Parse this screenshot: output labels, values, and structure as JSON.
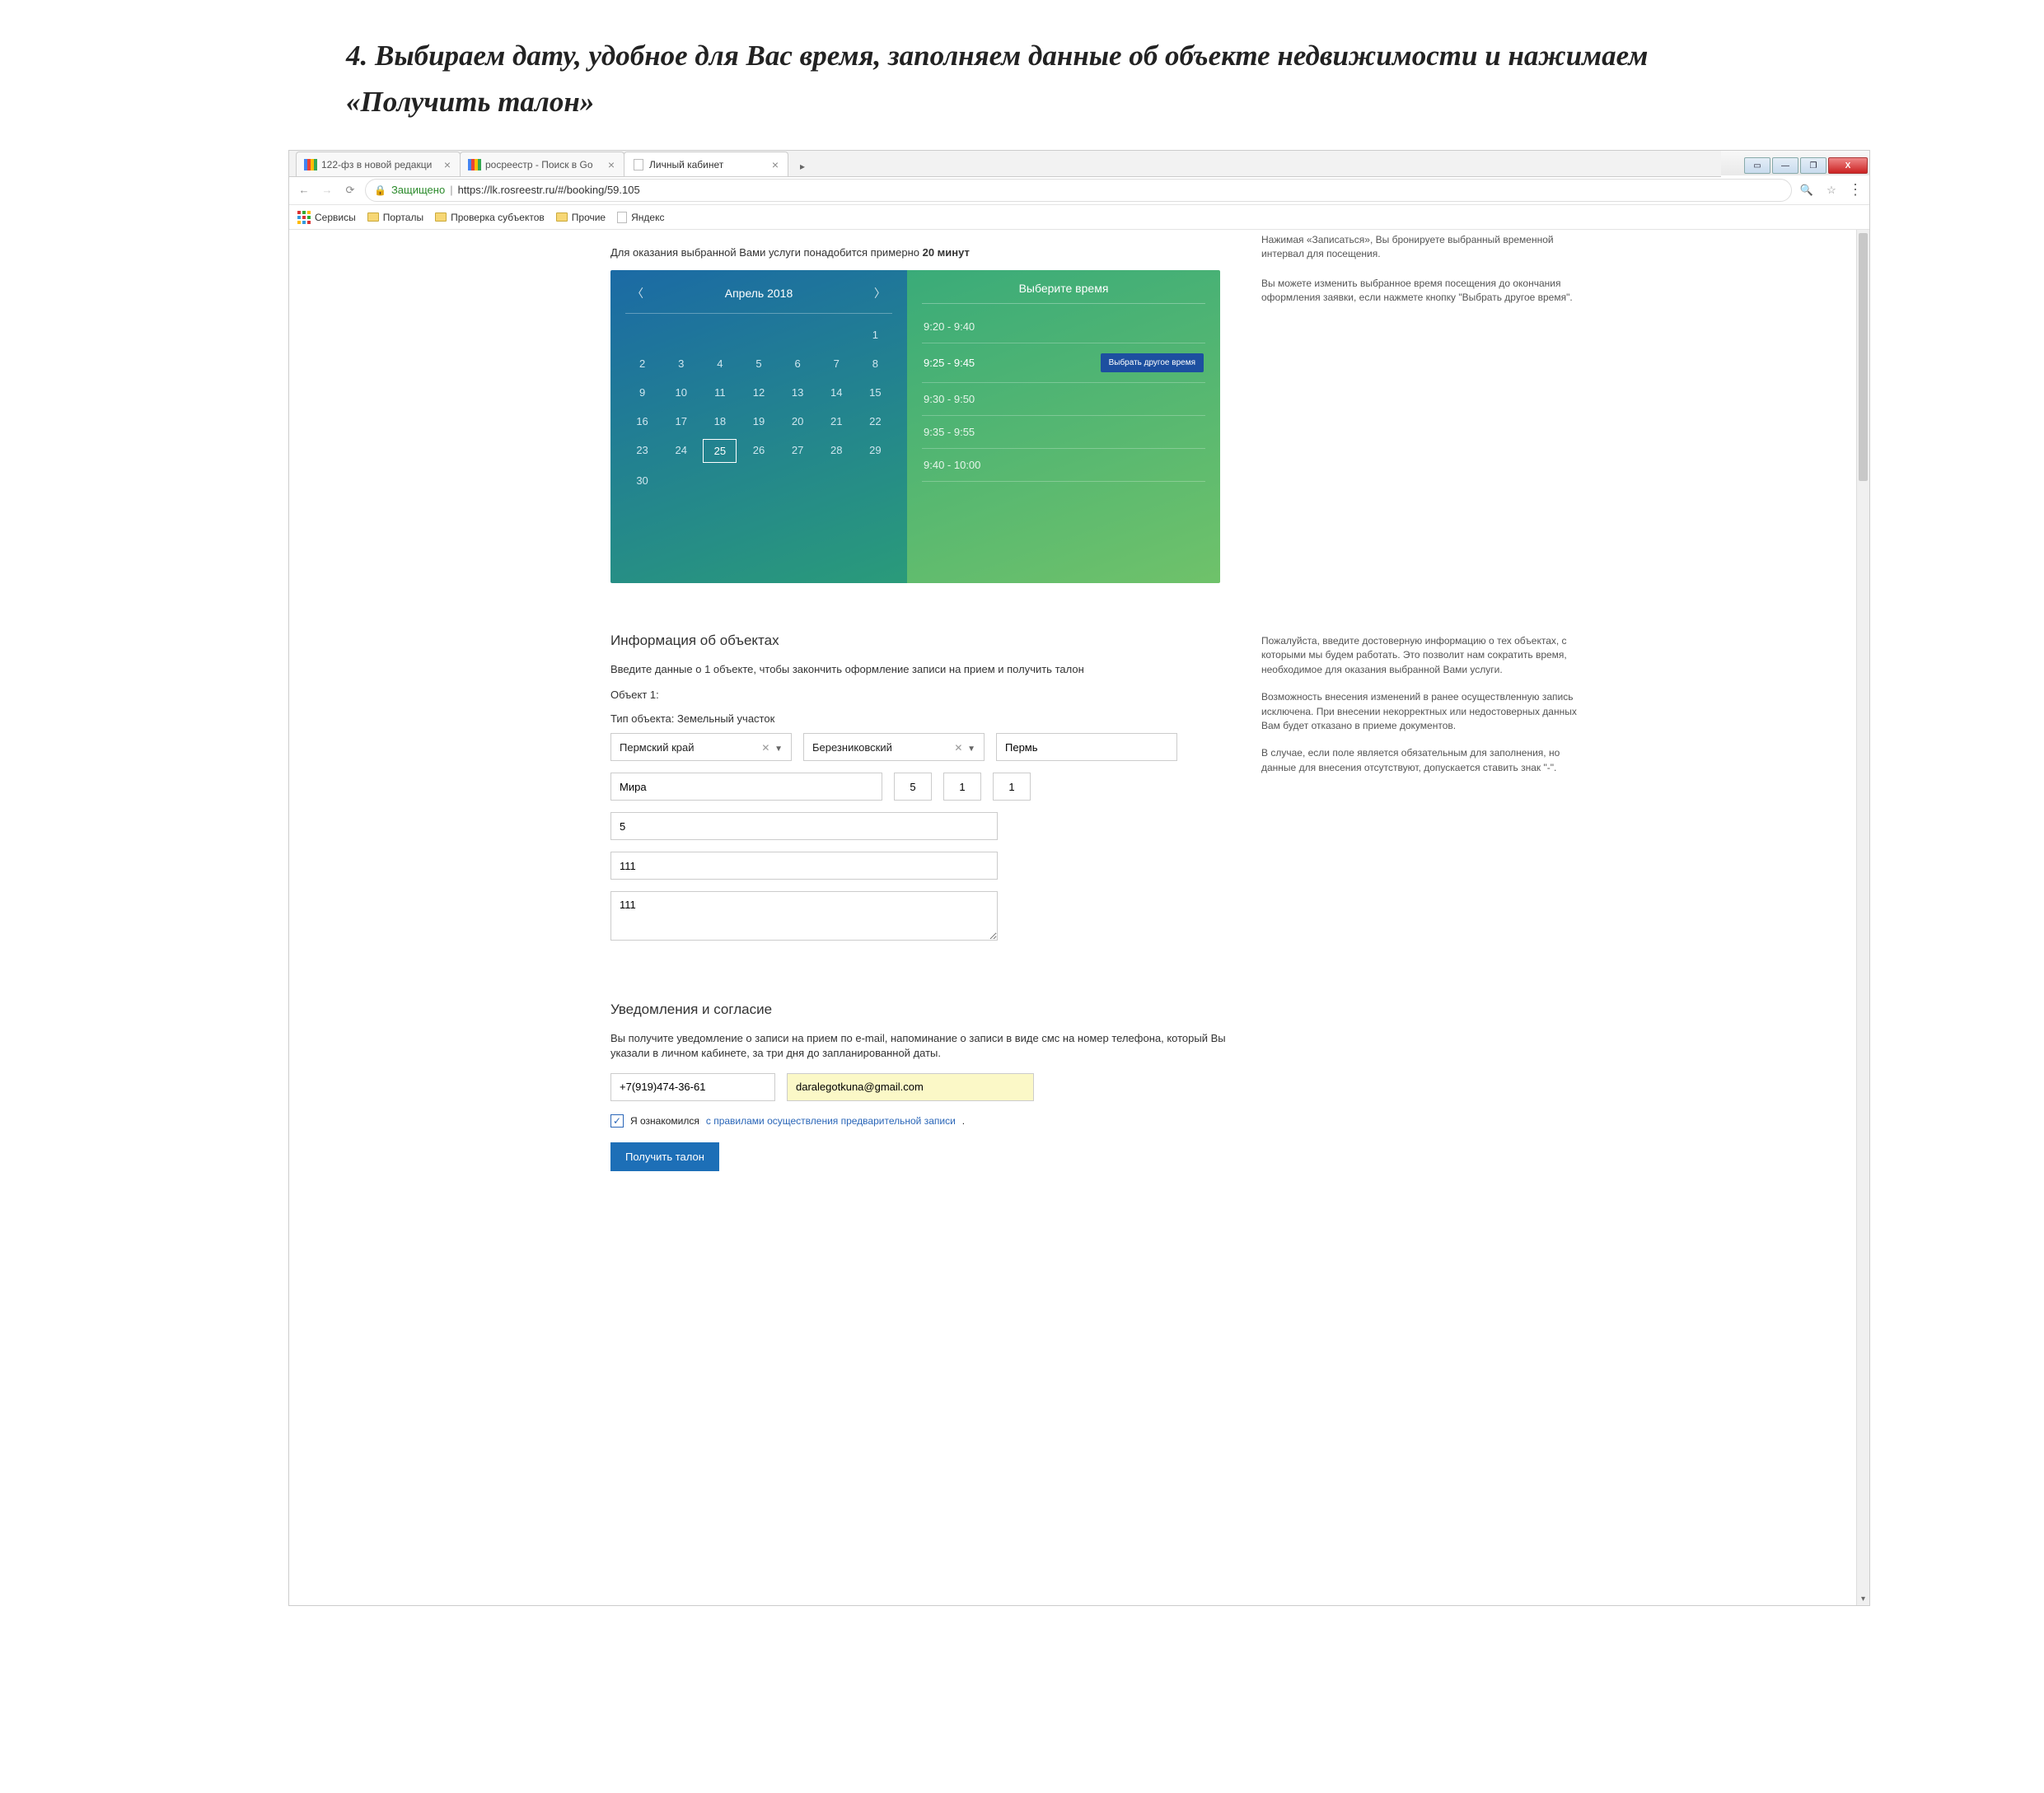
{
  "doc_heading": "4.   Выбираем дату, удобное для Вас время, заполняем данные об объекте недвижимости и нажимаем  «Получить талон»",
  "window": {
    "minimize": "—",
    "maximize": "❐",
    "restore": "▭",
    "close": "X"
  },
  "tabs": [
    {
      "label": "122-фз в новой редакци",
      "active": false,
      "fav": "google"
    },
    {
      "label": "росреестр - Поиск в Go",
      "active": false,
      "fav": "google"
    },
    {
      "label": "Личный кабинет",
      "active": true,
      "fav": "page"
    }
  ],
  "addr": {
    "secure": "Защищено",
    "url": "https://lk.rosreestr.ru/#/booking/59.105"
  },
  "bookmarks": {
    "apps": "Сервисы",
    "items": [
      {
        "type": "folder",
        "label": "Порталы"
      },
      {
        "type": "folder",
        "label": "Проверка субъектов"
      },
      {
        "type": "folder",
        "label": "Прочие"
      },
      {
        "type": "page",
        "label": "Яндекс"
      }
    ]
  },
  "booking": {
    "top_line_prefix": "Для оказания выбранной Вами услуги понадобится примерно ",
    "top_line_bold": "20 минут",
    "calendar": {
      "title": "Апрель 2018",
      "first_day_col": 6,
      "days_in_month": 30,
      "selected": 25
    },
    "times": {
      "title": "Выберите время",
      "slots": [
        "9:20 - 9:40",
        "9:25 - 9:45",
        "9:30 - 9:50",
        "9:35 - 9:55",
        "9:40 - 10:00"
      ],
      "selected_index": 1,
      "select_other": "Выбрать другое время"
    },
    "side_top_1": "Нажимая «Записаться», Вы бронируете выбранный временной интервал для посещения.",
    "side_top_2": "Вы можете изменить выбранное время посещения до окончания оформления заявки, если нажмете кнопку \"Выбрать другое время\"."
  },
  "objects": {
    "title": "Информация об объектах",
    "desc": "Введите данные о 1 объекте, чтобы закончить оформление записи на прием и получить талон",
    "obj_label": "Объект 1:",
    "type_label": "Тип объекта: Земельный участок",
    "region": "Пермский край",
    "district": "Березниковский",
    "city": "Пермь",
    "street": "Мира",
    "house": "5",
    "corp": "1",
    "flat": "1",
    "line5": "5",
    "line6": "111",
    "textarea": "111",
    "side_p1": "Пожалуйста, введите достоверную информацию о тех объектах, с которыми мы будем работать. Это позволит нам сократить время, необходимое для оказания выбранной Вами услуги.",
    "side_p2": "Возможность внесения изменений в ранее осуществленную запись исключена. При внесении некорректных или недостоверных данных Вам будет отказано в приеме документов.",
    "side_p3": "В случае, если поле является обязательным для заполнения, но данные для внесения отсутствуют, допускается ставить знак \"-\"."
  },
  "consent": {
    "title": "Уведомления и согласие",
    "desc": "Вы получите уведомление о записи на прием по e-mail, напоминание о записи в виде смс на номер телефона, который Вы указали в личном кабинете, за три дня до запланированной даты.",
    "phone": "+7(919)474-36-61",
    "email": "daralegotkuna@gmail.com",
    "check_label_pre": "Я ознакомился ",
    "check_link": "с правилами осуществления предварительной записи",
    "submit": "Получить талон"
  }
}
